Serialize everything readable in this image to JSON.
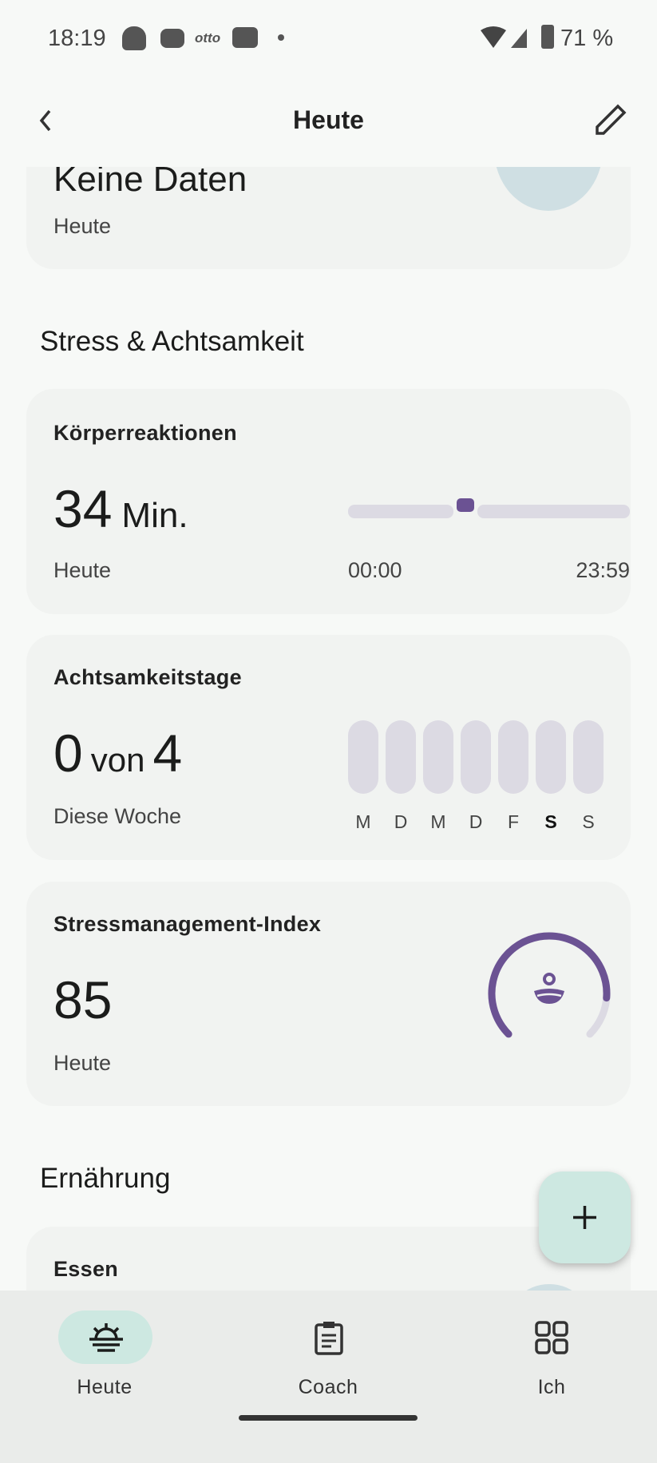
{
  "status_bar": {
    "time": "18:19",
    "battery": "71 %",
    "icons": [
      "snapchat-icon",
      "discord-icon",
      "otto-icon",
      "youtube-icon",
      "dot-icon",
      "wifi-icon",
      "signal-icon",
      "battery-icon"
    ]
  },
  "app_bar": {
    "title": "Heute",
    "back_icon": "chevron-left-icon",
    "edit_icon": "pencil-icon"
  },
  "partial_card": {
    "value": "Keine Daten",
    "sub": "Heute"
  },
  "sections": {
    "stress": "Stress & Achtsamkeit",
    "nutrition": "Ernährung"
  },
  "body_responses": {
    "title": "Körperreaktionen",
    "value": "34",
    "unit": "Min.",
    "sub": "Heute",
    "start": "00:00",
    "end": "23:59",
    "marker_time_fraction": 0.46
  },
  "mindful_days": {
    "title": "Achtsamkeitstage",
    "value": "0",
    "of": "von",
    "goal": "4",
    "sub": "Diese Woche",
    "days": [
      "M",
      "D",
      "M",
      "D",
      "F",
      "S",
      "S"
    ],
    "current_day_index": 5
  },
  "stress_index": {
    "title": "Stressmanagement-Index",
    "value": "85",
    "sub": "Heute",
    "max": 100,
    "color": "#6b5293"
  },
  "food": {
    "title": "Essen"
  },
  "fab": {
    "icon": "plus-icon"
  },
  "bottom_nav": [
    {
      "label": "Heute",
      "icon": "sunrise-icon",
      "active": true
    },
    {
      "label": "Coach",
      "icon": "clipboard-icon"
    },
    {
      "label": "Ich",
      "icon": "grid-icon"
    }
  ],
  "colors": {
    "accent": "#6b5293",
    "fab": "#cde8e1",
    "active_pill": "#cde8e1"
  }
}
